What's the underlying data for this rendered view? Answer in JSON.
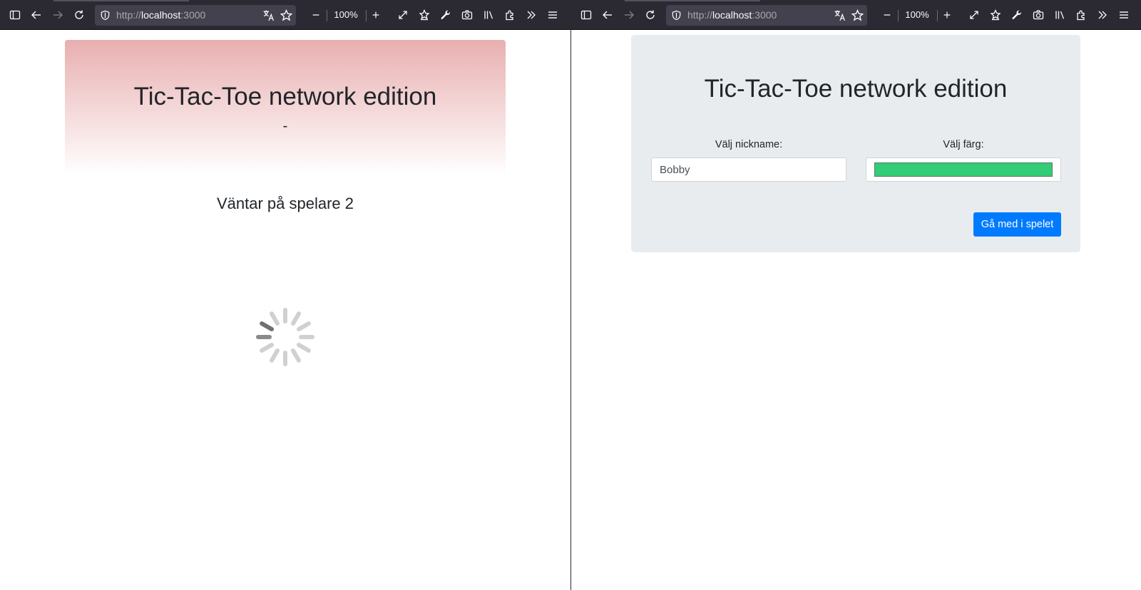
{
  "browser": {
    "url_scheme": "http://",
    "url_host": "localhost",
    "url_port": ":3000",
    "zoom_level": "100%"
  },
  "left": {
    "title": "Tic-Tac-Toe network edition",
    "subtitle": "-",
    "status": "Väntar på spelare 2",
    "header_color": "#e8afb0"
  },
  "right": {
    "title": "Tic-Tac-Toe network edition",
    "nickname_label": "Välj nickname:",
    "nickname_value": "Bobby",
    "color_label": "Välj färg:",
    "color_value": "#33cc77",
    "join_button": "Gå med i spelet",
    "button_color": "#007bff"
  }
}
